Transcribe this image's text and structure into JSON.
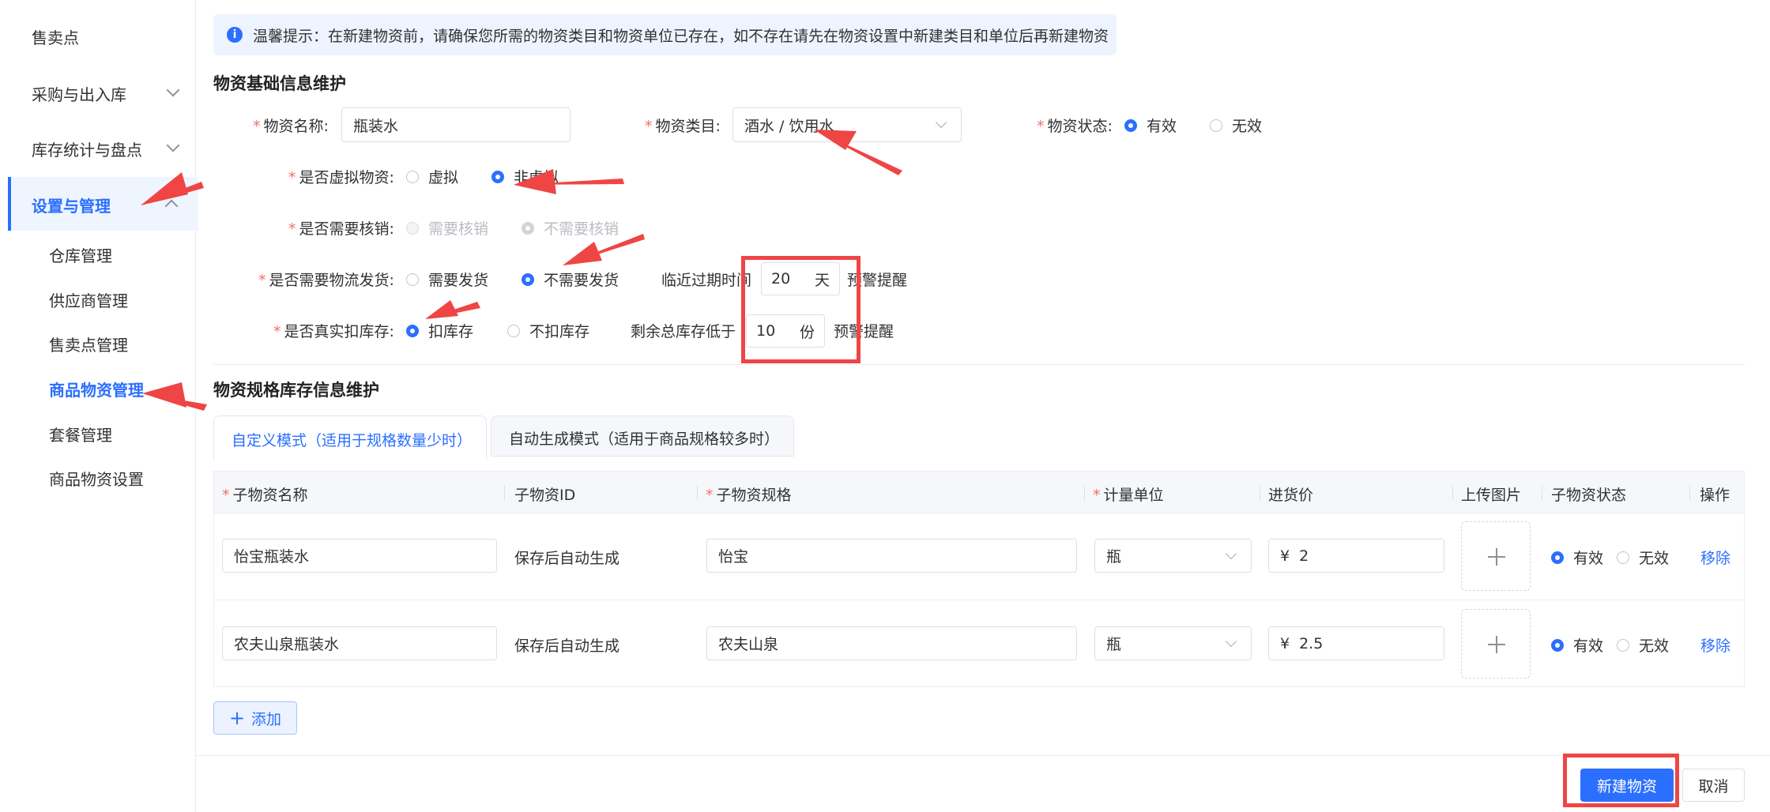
{
  "sidebar": {
    "items": [
      {
        "label": "售卖点"
      },
      {
        "label": "采购与出入库"
      },
      {
        "label": "库存统计与盘点"
      },
      {
        "label": "设置与管理"
      },
      {
        "label": "仓库管理"
      },
      {
        "label": "供应商管理"
      },
      {
        "label": "售卖点管理"
      },
      {
        "label": "商品物资管理"
      },
      {
        "label": "套餐管理"
      },
      {
        "label": "商品物资设置"
      }
    ]
  },
  "notice": {
    "text": "温馨提示：在新建物资前，请确保您所需的物资类目和物资单位已存在，如不存在请先在物资设置中新建类目和单位后再新建物资"
  },
  "basic": {
    "title": "物资基础信息维护",
    "name_label": "物资名称:",
    "name_value": "瓶装水",
    "category_label": "物资类目:",
    "category_value": "酒水 / 饮用水",
    "status_label": "物资状态:",
    "status_opt_valid": "有效",
    "status_opt_invalid": "无效",
    "virtual_label": "是否虚拟物资:",
    "virtual_opt_yes": "虚拟",
    "virtual_opt_no": "非虚拟",
    "verify_label": "是否需要核销:",
    "verify_opt_yes": "需要核销",
    "verify_opt_no": "不需要核销",
    "ship_label": "是否需要物流发货:",
    "ship_opt_yes": "需要发货",
    "ship_opt_no": "不需要发货",
    "expiry_label": "临近过期时间",
    "expiry_value": "20",
    "expiry_unit": "天",
    "expiry_suffix": "预警提醒",
    "stock_label": "是否真实扣库存:",
    "stock_opt_yes": "扣库存",
    "stock_opt_no": "不扣库存",
    "low_label": "剩余总库存低于",
    "low_value": "10",
    "low_unit": "份",
    "low_suffix": "预警提醒"
  },
  "spec": {
    "title": "物资规格库存信息维护",
    "tabs": [
      {
        "label": "自定义模式（适用于规格数量少时）"
      },
      {
        "label": "自动生成模式（适用于商品规格较多时）"
      }
    ],
    "headers": {
      "sub_name": "子物资名称",
      "sub_id": "子物资ID",
      "sub_spec": "子物资规格",
      "unit": "计量单位",
      "price": "进货价",
      "image": "上传图片",
      "status": "子物资状态",
      "op": "操作"
    },
    "rows": [
      {
        "name": "怡宝瓶装水",
        "id": "保存后自动生成",
        "spec": "怡宝",
        "unit": "瓶",
        "currency": "¥",
        "price": "2",
        "status_valid": "有效",
        "status_invalid": "无效",
        "remove": "移除"
      },
      {
        "name": "农夫山泉瓶装水",
        "id": "保存后自动生成",
        "spec": "农夫山泉",
        "unit": "瓶",
        "currency": "¥",
        "price": "2.5",
        "status_valid": "有效",
        "status_invalid": "无效",
        "remove": "移除"
      }
    ],
    "add_label": "添加"
  },
  "footer": {
    "create_label": "新建物资",
    "cancel_label": "取消"
  },
  "colors": {
    "primary": "#2b6fff",
    "annotation": "#ef4545",
    "required": "#f56c6c",
    "notice_bg": "#eef4ff"
  },
  "icons": {
    "notice": "info-icon",
    "add": "plus-icon",
    "upload": "plus-icon",
    "expand": "chevron-down-icon",
    "collapse": "chevron-up-icon"
  }
}
